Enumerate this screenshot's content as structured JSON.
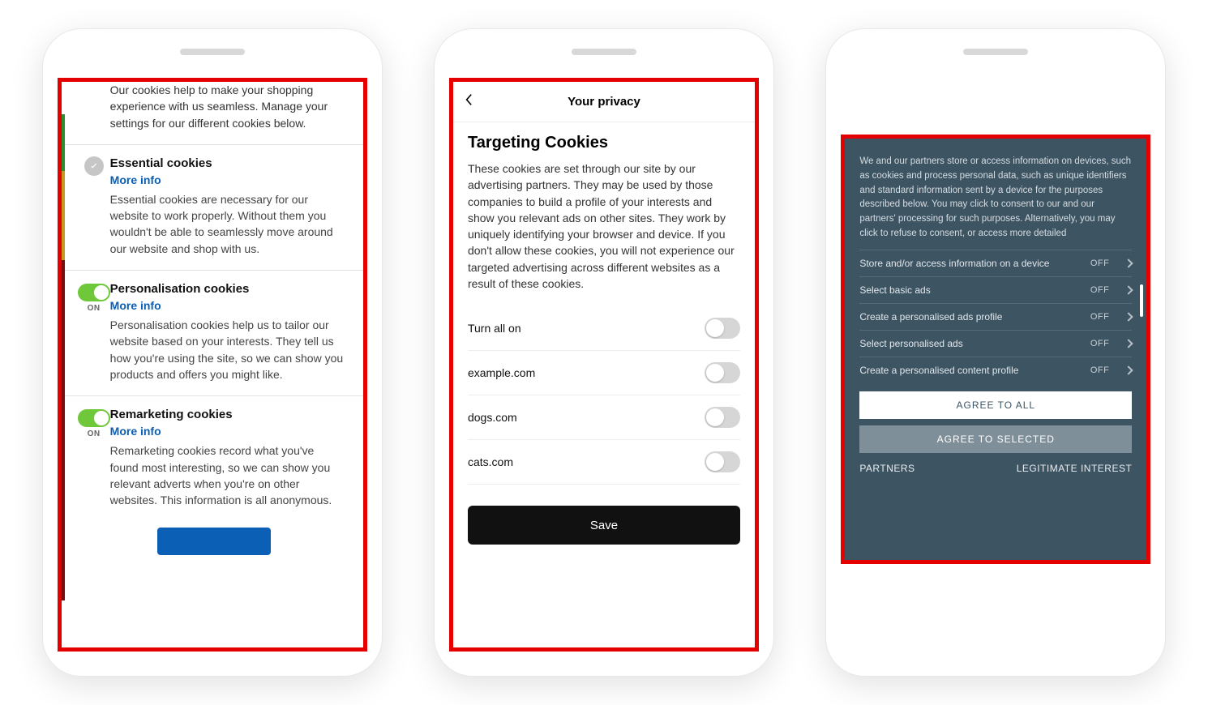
{
  "phone1": {
    "intro": "Our cookies help to make your shopping experience with us seamless. Manage your settings for our different cookies below.",
    "more_info": "More info",
    "toggle_on_label": "ON",
    "sections": {
      "essential": {
        "title": "Essential cookies",
        "desc": "Essential cookies are necessary for our website to work properly. Without them you wouldn't be able to seamlessly move around our website and shop with us."
      },
      "personalisation": {
        "title": "Personalisation cookies",
        "desc": "Personalisation cookies help us to tailor our website based on your interests. They tell us how you're using the site, so we can show you products and offers you might like."
      },
      "remarketing": {
        "title": "Remarketing cookies",
        "desc": "Remarketing cookies record what you've found most interesting, so we can show you relevant adverts when you're on other websites. This information is all anonymous."
      }
    }
  },
  "phone2": {
    "header": "Your privacy",
    "heading": "Targeting Cookies",
    "desc": "These cookies are set through our site by our advertising partners. They may be used by those companies to build a profile of your interests and show you relevant ads on other sites. They work by uniquely identifying your browser and device. If you don't allow these cookies, you will not experience our targeted advertising across different websites as a result of these cookies.",
    "rows": {
      "all": "Turn all on",
      "r1": "example.com",
      "r2": "dogs.com",
      "r3": "cats.com"
    },
    "save": "Save"
  },
  "phone3": {
    "intro": "We and our partners store or access information on devices, such as cookies and process personal data, such as unique identifiers and standard information sent by a device for the purposes described below. You may click to consent to our and our partners' processing for such purposes. Alternatively, you may click to refuse to consent, or access more detailed",
    "off": "OFF",
    "rows": {
      "r1": "Store and/or access information on a device",
      "r2": "Select basic ads",
      "r3": "Create a personalised ads profile",
      "r4": "Select personalised ads",
      "r5": "Create a personalised content profile"
    },
    "agree_all": "AGREE TO ALL",
    "agree_selected": "AGREE TO SELECTED",
    "partners": "PARTNERS",
    "legitimate": "LEGITIMATE INTEREST"
  }
}
